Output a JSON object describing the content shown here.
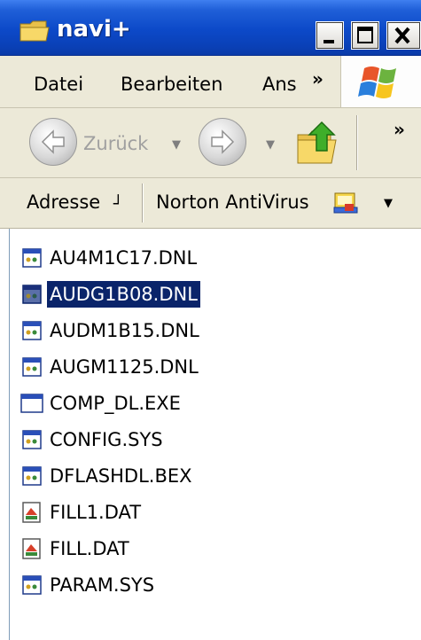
{
  "window": {
    "title": "navi+"
  },
  "menubar": {
    "items": [
      "Datei",
      "Bearbeiten",
      "Ans"
    ],
    "overflow": "»"
  },
  "toolbar": {
    "back_label": "Zurück",
    "overflow": "»"
  },
  "addressbar": {
    "address_label": "Adresse",
    "norton_label": "Norton AntiVirus"
  },
  "files": [
    {
      "name": "AU4M1C17.DNL",
      "icon": "system-file-icon",
      "selected": false
    },
    {
      "name": "AUDG1B08.DNL",
      "icon": "system-file-icon",
      "selected": true
    },
    {
      "name": "AUDM1B15.DNL",
      "icon": "system-file-icon",
      "selected": false
    },
    {
      "name": "AUGM1125.DNL",
      "icon": "system-file-icon",
      "selected": false
    },
    {
      "name": "COMP_DL.EXE",
      "icon": "executable-icon",
      "selected": false
    },
    {
      "name": "CONFIG.SYS",
      "icon": "system-file-icon",
      "selected": false
    },
    {
      "name": "DFLASHDL.BEX",
      "icon": "system-file-icon",
      "selected": false
    },
    {
      "name": "FILL1.DAT",
      "icon": "data-file-icon",
      "selected": false
    },
    {
      "name": "FILL.DAT",
      "icon": "data-file-icon",
      "selected": false
    },
    {
      "name": "PARAM.SYS",
      "icon": "system-file-icon",
      "selected": false
    }
  ],
  "colors": {
    "title_bar": "#0a40b6",
    "selection": "#0a246a",
    "chrome": "#ece9d8"
  }
}
